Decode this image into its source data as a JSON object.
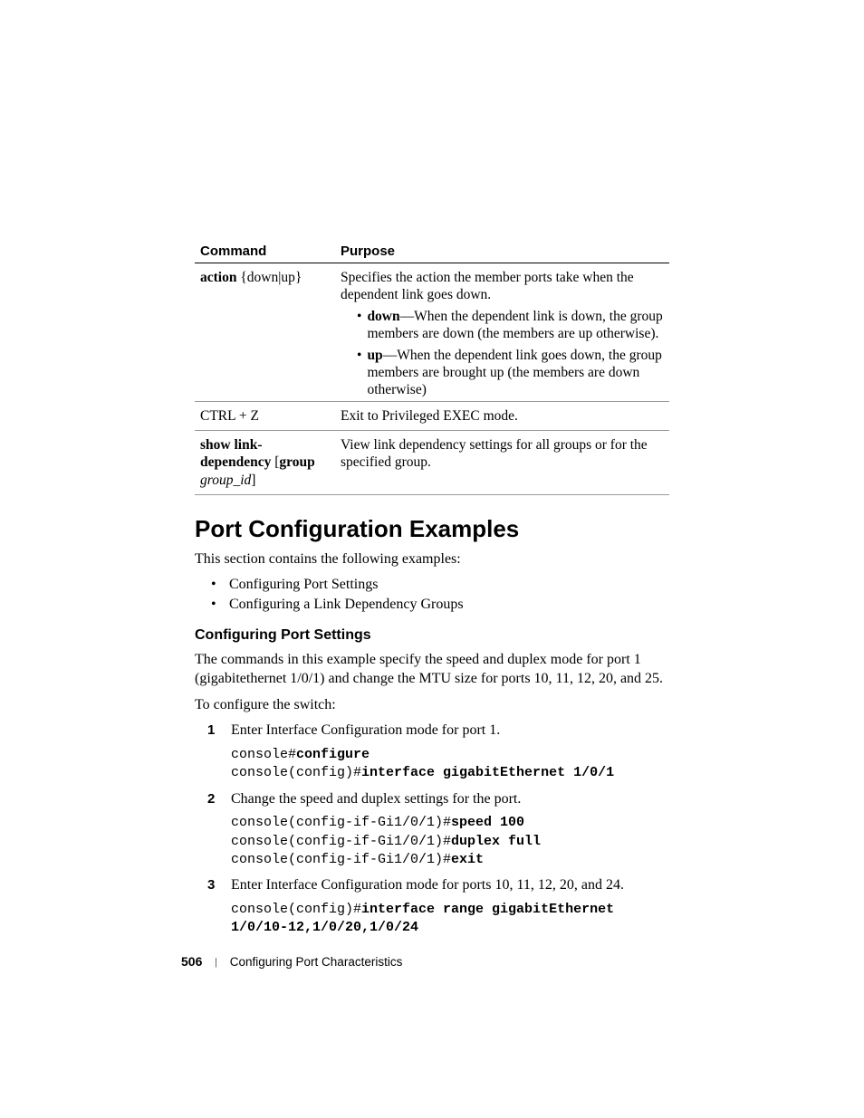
{
  "table": {
    "headers": {
      "command": "Command",
      "purpose": "Purpose"
    },
    "row1": {
      "cmd_a": "action",
      "cmd_b": "{down|up}",
      "desc": "Specifies the action the member ports take when the dependent link goes down.",
      "b1_kw": "down",
      "b1_rest": "—When the dependent link is down, the group members are down (the members are up otherwise).",
      "b2_kw": "up",
      "b2_rest": "—When the dependent link goes down, the group members are brought up (the members are down otherwise)"
    },
    "row2": {
      "cmd": "CTRL + Z",
      "desc": "Exit to Privileged EXEC mode."
    },
    "row3": {
      "cmd_a": "show link-dependency",
      "cmd_b": "[",
      "cmd_c": "group",
      "cmd_d": " group_id",
      "cmd_e": "]",
      "desc": "View link dependency settings for all groups or for the specified group."
    }
  },
  "section_title": "Port Configuration Examples",
  "intro": "This section contains the following examples:",
  "toc": {
    "i1": "Configuring Port Settings",
    "i2": "Configuring a Link Dependency Groups"
  },
  "sub_title": "Configuring Port Settings",
  "sub_intro": "The commands in this example specify the speed and duplex mode for port 1 (gigabitethernet 1/0/1) and change the MTU size for ports 10, 11, 12, 20, and 25.",
  "sub_lead": "To configure the switch:",
  "steps": {
    "s1": {
      "text": "Enter Interface Configuration mode for port 1.",
      "l1_p": "console#",
      "l1_c": "configure",
      "l2_p": "console(config)#",
      "l2_c": "interface gigabitEthernet 1/0/1"
    },
    "s2": {
      "text": "Change the speed and duplex settings for the port.",
      "l1_p": "console(config-if-Gi1/0/1)#",
      "l1_c": "speed 100",
      "l2_p": "console(config-if-Gi1/0/1)#",
      "l2_c": "duplex full",
      "l3_p": "console(config-if-Gi1/0/1)#",
      "l3_c": "exit"
    },
    "s3": {
      "text": "Enter Interface Configuration mode for ports 10, 11, 12, 20, and 24.",
      "l1_p": "console(config)#",
      "l1_c": "interface range gigabitEthernet 1/0/10-12,1/0/20,1/0/24"
    }
  },
  "footer": {
    "page": "506",
    "chapter": "Configuring Port Characteristics"
  }
}
